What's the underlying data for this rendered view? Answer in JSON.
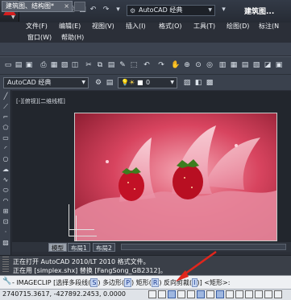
{
  "title": {
    "workspace": "AutoCAD 经典",
    "app_title": "建筑图..."
  },
  "menus": {
    "row1": [
      "文件(F)",
      "编辑(E)",
      "视图(V)",
      "插入(I)",
      "格式(O)",
      "工具(T)",
      "绘图(D)",
      "标注(N"
    ],
    "row2": [
      "窗口(W)",
      "帮助(H)"
    ]
  },
  "tabs": {
    "document": "建筑图、结构图*"
  },
  "toolbar": {
    "workspace_combo": "AutoCAD 经典",
    "layer_value": "0"
  },
  "viewport": {
    "label": "[-][俯视][二维线框]"
  },
  "layout_tabs": [
    "模型",
    "布局1",
    "布局2"
  ],
  "command_history": [
    "正在打开 AutoCAD 2010/LT 2010 格式文件。",
    "正在用 [simplex.shx] 替换 [FangSong_GB2312]。"
  ],
  "command_line": {
    "command": "IMAGECLIP",
    "options": [
      {
        "label": "选择多段线",
        "key": "S"
      },
      {
        "label": "多边形",
        "key": "P"
      },
      {
        "label": "矩形",
        "key": "R"
      },
      {
        "label": "反向剪裁",
        "key": "I"
      }
    ],
    "default": "<矩形>:"
  },
  "status": {
    "coords": "2740715.3617, -427892.2453, 0.0000"
  },
  "colors": {
    "accent_red": "#e1261c",
    "photo_bg": "#b0243a"
  }
}
